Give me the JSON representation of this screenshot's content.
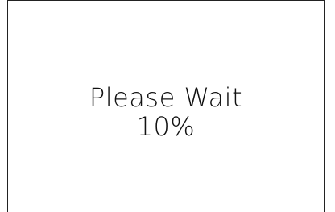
{
  "dialog": {
    "message": "Please Wait",
    "progress_text": "10%",
    "progress_fraction": 0.1
  }
}
